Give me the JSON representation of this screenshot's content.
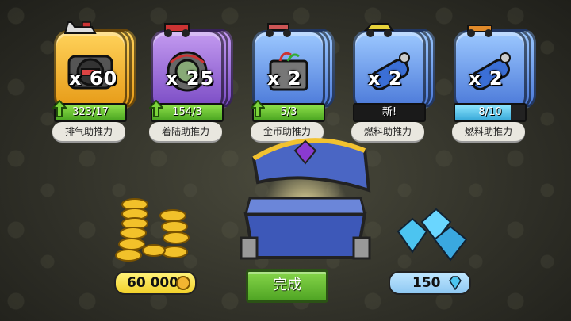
{
  "cards": [
    {
      "count": "x 60",
      "progress_text": "323/17",
      "progress": 1.0,
      "label": "排气助推力",
      "theme": "gold",
      "bar": "green",
      "has_arrow": true,
      "vehicle": "snowmobile-icon",
      "item": "exhaust-booster-icon"
    },
    {
      "count": "x 25",
      "progress_text": "154/3",
      "progress": 1.0,
      "label": "着陆助推力",
      "theme": "purple",
      "bar": "green",
      "has_arrow": true,
      "vehicle": "buggy-icon",
      "item": "landing-booster-icon"
    },
    {
      "count": "x 2",
      "progress_text": "5/3",
      "progress": 1.0,
      "label": "金币助推力",
      "theme": "blue",
      "bar": "green",
      "has_arrow": true,
      "vehicle": "atv-icon",
      "item": "coin-booster-icon"
    },
    {
      "count": "x 2",
      "progress_text": "新!",
      "progress": 0,
      "label": "燃料助推力",
      "theme": "blue",
      "bar": "plain",
      "has_arrow": false,
      "vehicle": "dune-buggy-icon",
      "item": "fuel-booster-icon"
    },
    {
      "count": "x 2",
      "progress_text": "8/10",
      "progress": 0.8,
      "label": "燃料助推力",
      "theme": "blue",
      "bar": "cyan",
      "has_arrow": false,
      "vehicle": "tow-truck-icon",
      "item": "fuel-booster-icon"
    }
  ],
  "rewards": {
    "coins": "60 000",
    "gems": "150"
  },
  "done_button": "完成",
  "colors": {
    "gold": "#f2b531",
    "purple": "#8a5ad4",
    "blue": "#5b8ae0",
    "green": "#4aa521",
    "cyan": "#37a8d8"
  }
}
